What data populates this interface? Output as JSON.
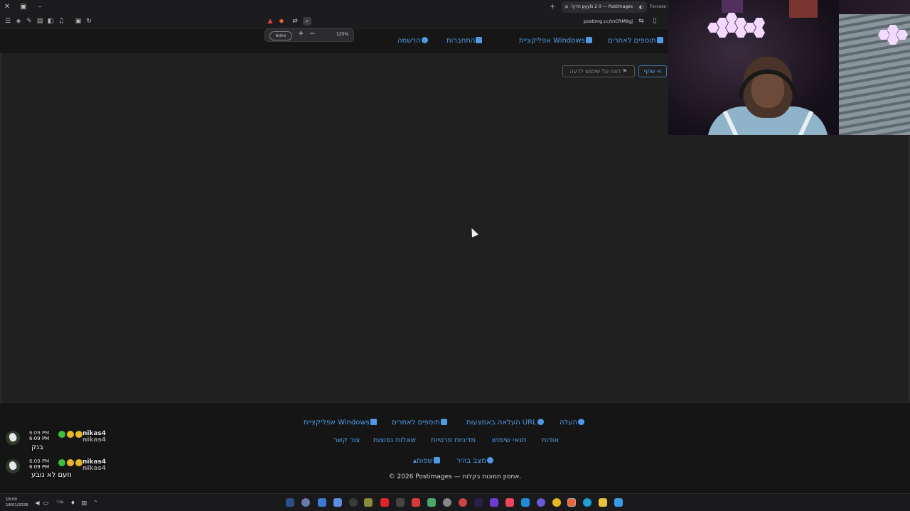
{
  "browser": {
    "active_tab_title": "ly'm pyyls 2 0 — Postimages",
    "next_tab_title": "Forcese S",
    "url": "postimg.cc/tnCRM9gj",
    "zoom_reset_label": "איפוס",
    "zoom_level": "125%"
  },
  "site_nav": {
    "addons": "תוספים לאתרים",
    "windows_app": "אפליקציית Windows",
    "login": "התחברות",
    "register": "הרשמה"
  },
  "actions": {
    "share": "שתף",
    "report": "דווח על שימוש לרעה"
  },
  "footer": {
    "row1": [
      "העלה",
      "העלאה באמצעות URL",
      "תוספים לאתרים",
      "אפליקציית Windows"
    ],
    "row2": [
      "אודות",
      "תנאי שימוש",
      "מדיניות פרטיות",
      "שאלות נפוצות",
      "צור קשר"
    ],
    "row3": [
      "מצב בהיר",
      "שפות"
    ],
    "copyright": "© 2026 Postimages — אחסון תמונות בקלות."
  },
  "chat": [
    {
      "time": "6:09 PM",
      "user": "nikas4",
      "ghost_user": "nikas4",
      "ghost_time": "6:09 PM",
      "message": "בנק"
    },
    {
      "time": "6:09 PM",
      "user": "nikas4",
      "ghost_user": "nikas4",
      "ghost_time": "6:09 PM",
      "message": "וזעם לא נובע"
    }
  ],
  "taskbar": {
    "time": "18:09",
    "date": "18/01/2026",
    "language": "עבר"
  },
  "colors": {
    "link": "#4f9ae6",
    "page_bg": "#202020",
    "nav_bg": "#161616"
  }
}
